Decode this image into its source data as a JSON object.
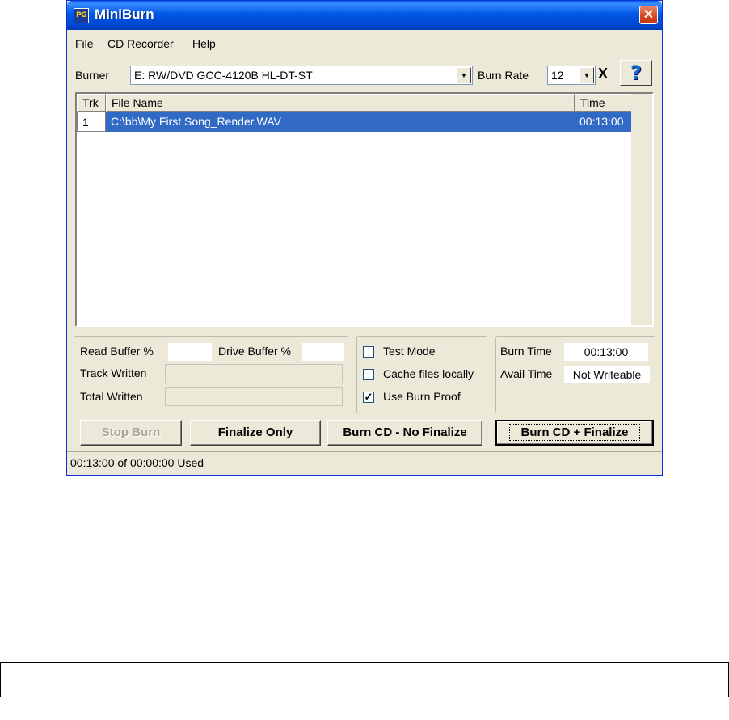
{
  "window": {
    "title": "MiniBurn",
    "logo_text": "PG",
    "close_label": "✕"
  },
  "menu": [
    "File",
    "CD Recorder",
    "Help"
  ],
  "burner": {
    "label": "Burner",
    "value": "E: RW/DVD GCC-4120B HL-DT-ST"
  },
  "burn_rate": {
    "label": "Burn Rate",
    "value": "12",
    "clear_label": "X"
  },
  "help_label": "?",
  "track_list": {
    "columns": [
      "Trk",
      "File Name",
      "Time"
    ],
    "rows": [
      {
        "trk": "1",
        "file": "C:\\bb\\My First Song_Render.WAV",
        "time": "00:13:00",
        "selected": true
      }
    ]
  },
  "buffers": {
    "read_buffer_label": "Read Buffer %",
    "read_buffer_value": "",
    "drive_buffer_label": "Drive Buffer %",
    "drive_buffer_value": "",
    "track_written_label": "Track Written",
    "total_written_label": "Total Written"
  },
  "options": {
    "test_mode": {
      "label": "Test Mode",
      "checked": false
    },
    "cache_files": {
      "label": "Cache files locally",
      "checked": false
    },
    "burn_proof": {
      "label": "Use Burn Proof",
      "checked": true
    }
  },
  "times": {
    "burn_time_label": "Burn Time",
    "burn_time_value": "00:13:00",
    "avail_time_label": "Avail Time",
    "avail_time_value": "Not Writeable"
  },
  "buttons": {
    "stop_burn": "Stop Burn",
    "finalize_only": "Finalize Only",
    "burn_no_finalize": "Burn CD - No Finalize",
    "burn_finalize": "Burn CD + Finalize"
  },
  "status": "00:13:00 of 00:00:00 Used",
  "colors": {
    "selection": "#316ac5",
    "title_bar": "#0058e6",
    "window_face": "#ece9d8"
  }
}
